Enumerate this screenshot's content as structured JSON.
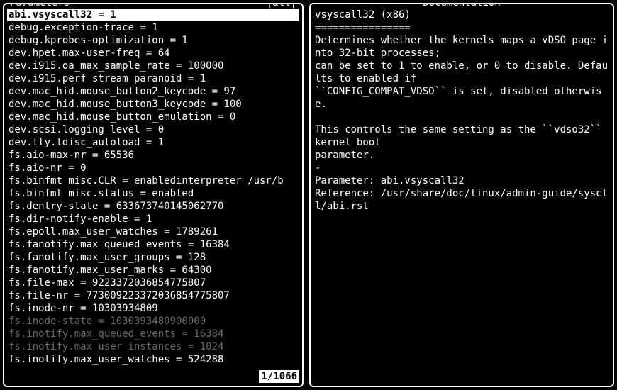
{
  "left": {
    "title": "Parameters",
    "filter": "|all|",
    "counter": "1/1066",
    "selected_index": 0,
    "params": [
      {
        "text": "abi.vsyscall32 = 1",
        "dim": false
      },
      {
        "text": "debug.exception-trace = 1",
        "dim": false
      },
      {
        "text": "debug.kprobes-optimization = 1",
        "dim": false
      },
      {
        "text": "dev.hpet.max-user-freq = 64",
        "dim": false
      },
      {
        "text": "dev.i915.oa_max_sample_rate = 100000",
        "dim": false
      },
      {
        "text": "dev.i915.perf_stream_paranoid = 1",
        "dim": false
      },
      {
        "text": "dev.mac_hid.mouse_button2_keycode = 97",
        "dim": false
      },
      {
        "text": "dev.mac_hid.mouse_button3_keycode = 100",
        "dim": false
      },
      {
        "text": "dev.mac_hid.mouse_button_emulation = 0",
        "dim": false
      },
      {
        "text": "dev.scsi.logging_level = 0",
        "dim": false
      },
      {
        "text": "dev.tty.ldisc_autoload = 1",
        "dim": false
      },
      {
        "text": "fs.aio-max-nr = 65536",
        "dim": false
      },
      {
        "text": "fs.aio-nr = 0",
        "dim": false
      },
      {
        "text": "fs.binfmt_misc.CLR = enabledinterpreter /usr/b",
        "dim": false
      },
      {
        "text": "fs.binfmt_misc.status = enabled",
        "dim": false
      },
      {
        "text": "fs.dentry-state = 633673740145062770",
        "dim": false
      },
      {
        "text": "fs.dir-notify-enable = 1",
        "dim": false
      },
      {
        "text": "fs.epoll.max_user_watches = 1789261",
        "dim": false
      },
      {
        "text": "fs.fanotify.max_queued_events = 16384",
        "dim": false
      },
      {
        "text": "fs.fanotify.max_user_groups = 128",
        "dim": false
      },
      {
        "text": "fs.fanotify.max_user_marks = 64300",
        "dim": false
      },
      {
        "text": "fs.file-max = 9223372036854775807",
        "dim": false
      },
      {
        "text": "fs.file-nr = 77300922337203685477580​7",
        "dim": false
      },
      {
        "text": "fs.inode-nr = 10303934809",
        "dim": false
      },
      {
        "text": "fs.inode-state = 1030393480900000",
        "dim": true
      },
      {
        "text": "fs.inotify.max_queued_events = 16384",
        "dim": true
      },
      {
        "text": "fs.inotify.max_user_instances = 1024",
        "dim": true
      },
      {
        "text": "fs.inotify.max_user_watches = 524288",
        "dim": false
      }
    ]
  },
  "right": {
    "title": "Documentation",
    "lines": [
      "vsyscall32 (x86)",
      "================",
      "Determines whether the kernels maps a vDSO page into 32-bit processes;",
      "can be set to 1 to enable, or 0 to disable. Defaults to enabled if",
      "``CONFIG_COMPAT_VDSO`` is set, disabled otherwise.",
      "",
      "This controls the same setting as the ``vdso32`` kernel boot",
      "parameter.",
      "-",
      "Parameter: abi.vsyscall32",
      "Reference: /usr/share/doc/linux/admin-guide/sysctl/abi.rst"
    ]
  }
}
